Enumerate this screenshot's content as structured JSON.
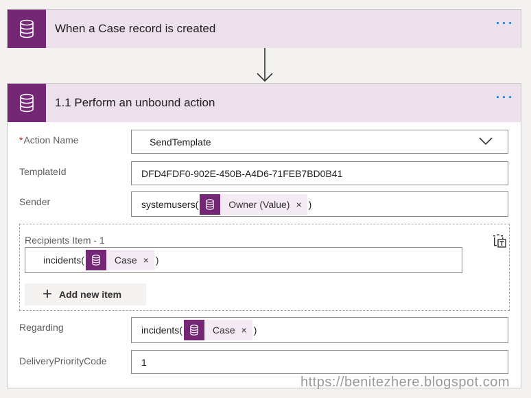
{
  "trigger": {
    "title": "When a Case record is created",
    "icon": "database-icon"
  },
  "action": {
    "title": "1.1 Perform an unbound action",
    "icon": "database-icon",
    "fields": {
      "action_name": {
        "required_mark": "*",
        "label": "Action Name",
        "value": "SendTemplate"
      },
      "template_id": {
        "label": "TemplateId",
        "value": "DFD4FDF0-902E-450B-A4D6-71FEB7BD0B41"
      },
      "sender": {
        "label": "Sender",
        "prefix": "systemusers(",
        "token": "Owner (Value)",
        "suffix": ")"
      },
      "recipients": {
        "label": "Recipients Item - 1",
        "prefix": "incidents(",
        "token": "Case",
        "suffix": ")",
        "add_label": "Add new item"
      },
      "regarding": {
        "label": "Regarding",
        "prefix": "incidents(",
        "token": "Case",
        "suffix": ")"
      },
      "delivery_priority": {
        "label": "DeliveryPriorityCode",
        "value": "1"
      }
    }
  },
  "token_close": "×",
  "watermark": "https://benitezhere.blogspot.com",
  "colors": {
    "accent": "#742774",
    "header_bg": "#ece0ec",
    "token_bg": "#f4eaf4",
    "link": "#0078d4"
  }
}
